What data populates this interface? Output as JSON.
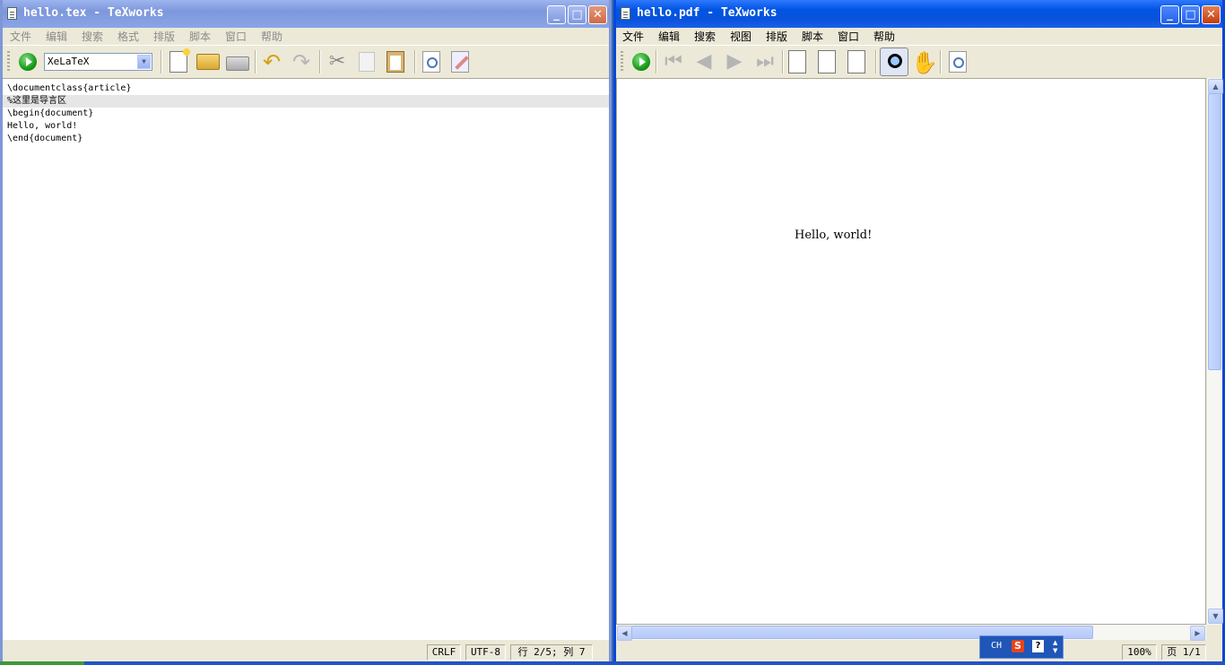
{
  "left_window": {
    "title": "hello.tex - TeXworks",
    "menu": [
      "文件",
      "编辑",
      "搜索",
      "格式",
      "排版",
      "脚本",
      "窗口",
      "帮助"
    ],
    "engine": "XeLaTeX",
    "lines": [
      "\\documentclass{article}",
      "%这里是导言区",
      "\\begin{document}",
      "Hello, world!",
      "\\end{document}"
    ],
    "status": {
      "line_ending": "CRLF",
      "encoding": "UTF-8",
      "position": "行 2/5; 列 7"
    }
  },
  "right_window": {
    "title": "hello.pdf - TeXworks",
    "menu": [
      "文件",
      "编辑",
      "搜索",
      "视图",
      "排版",
      "脚本",
      "窗口",
      "帮助"
    ],
    "pdf_text": "Hello, world!",
    "status": {
      "zoom": "100%",
      "page": "页 1/1"
    }
  },
  "ime": {
    "mode": "CH"
  },
  "window_buttons": {
    "minimize": "_",
    "maximize": "□",
    "close": "✕"
  },
  "colors": {
    "active_title": "#0054e3",
    "inactive_title": "#7d97dc",
    "chrome": "#ece9d8"
  }
}
